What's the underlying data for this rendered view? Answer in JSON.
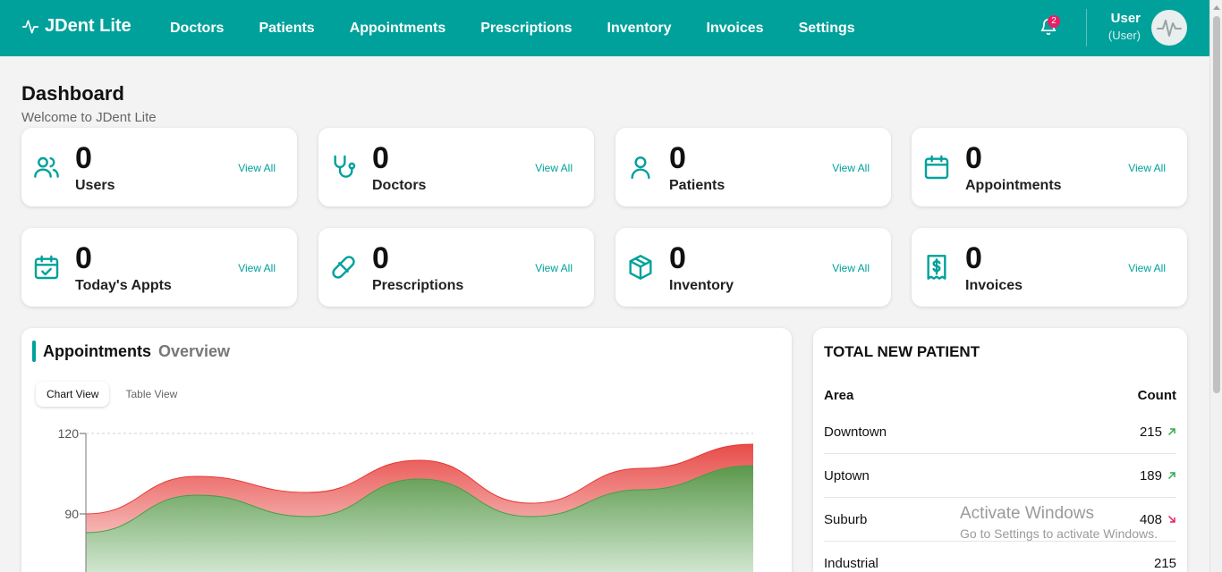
{
  "app": {
    "title": "JDent Lite"
  },
  "nav": {
    "items": [
      "Doctors",
      "Patients",
      "Appointments",
      "Prescriptions",
      "Inventory",
      "Invoices",
      "Settings"
    ]
  },
  "notifications": {
    "count": "2"
  },
  "user": {
    "name": "User",
    "role": "(User)"
  },
  "page": {
    "title": "Dashboard",
    "subtitle": "Welcome to JDent Lite"
  },
  "stats": [
    {
      "value": "0",
      "label": "Users",
      "link": "View All",
      "icon": "users-icon"
    },
    {
      "value": "0",
      "label": "Doctors",
      "link": "View All",
      "icon": "stethoscope-icon"
    },
    {
      "value": "0",
      "label": "Patients",
      "link": "View All",
      "icon": "user-icon"
    },
    {
      "value": "0",
      "label": "Appointments",
      "link": "View All",
      "icon": "calendar-icon"
    },
    {
      "value": "0",
      "label": "Today's Appts",
      "link": "View All",
      "icon": "calendar-check-icon"
    },
    {
      "value": "0",
      "label": "Prescriptions",
      "link": "View All",
      "icon": "pill-icon"
    },
    {
      "value": "0",
      "label": "Inventory",
      "link": "View All",
      "icon": "box-icon"
    },
    {
      "value": "0",
      "label": "Invoices",
      "link": "View All",
      "icon": "invoice-icon"
    }
  ],
  "overview": {
    "title_bold": "Appointments",
    "title_muted": "Overview",
    "tabs": [
      "Chart View",
      "Table View"
    ],
    "active_tab": "Chart View"
  },
  "chart_data": {
    "type": "area",
    "ylim": [
      60,
      120
    ],
    "yticks": [
      90,
      120
    ],
    "series": [
      {
        "color": "#e53935",
        "values": [
          90,
          104,
          98,
          110,
          94,
          107,
          116
        ]
      },
      {
        "color": "#43a047",
        "values": [
          83,
          97,
          89,
          103,
          89,
          99,
          108
        ]
      }
    ],
    "grid": true
  },
  "new_patients": {
    "title": "TOTAL NEW PATIENT",
    "col_area": "Area",
    "col_count": "Count",
    "rows": [
      {
        "area": "Downtown",
        "count": "215",
        "trend": "up"
      },
      {
        "area": "Uptown",
        "count": "189",
        "trend": "up"
      },
      {
        "area": "Suburb",
        "count": "408",
        "trend": "down"
      },
      {
        "area": "Industrial",
        "count": "215",
        "trend": "none"
      }
    ]
  },
  "watermark": {
    "line1": "Activate Windows",
    "line2": "Go to Settings to activate Windows."
  },
  "colors": {
    "brand": "#00a19b",
    "up": "#2fa84f",
    "down": "#e91e63"
  }
}
